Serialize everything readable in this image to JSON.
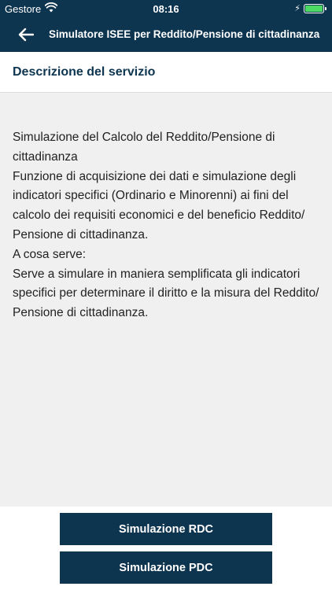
{
  "status_bar": {
    "carrier": "Gestore",
    "time": "08:16",
    "battery_level": 1.0,
    "icons": [
      "wifi-icon",
      "charging-icon",
      "battery-icon"
    ]
  },
  "nav": {
    "title": "Simulatore ISEE per Reddito/Pensione di cittadinanza",
    "back_icon": "arrow-left-icon"
  },
  "section": {
    "title": "Descrizione del servizio"
  },
  "description": {
    "paragraphs": [
      "Simulazione del Calcolo del Reddito/Pensione di cittadinanza",
      "Funzione di acquisizione dei dati e simulazione degli indicatori specifici (Ordinario e Minorenni) ai fini del calcolo dei requisiti economici e del beneficio Reddito/ Pensione di cittadinanza.",
      "A cosa serve:",
      "Serve a simulare in maniera semplificata gli indicatori specifici per determinare il diritto e la misura del Reddito/ Pensione di cittadinanza."
    ]
  },
  "buttons": {
    "rdc_label": "Simulazione RDC",
    "pdc_label": "Simulazione PDC"
  },
  "colors": {
    "primary": "#0e3550",
    "background": "#f0f0f0",
    "battery": "#4cd964"
  }
}
